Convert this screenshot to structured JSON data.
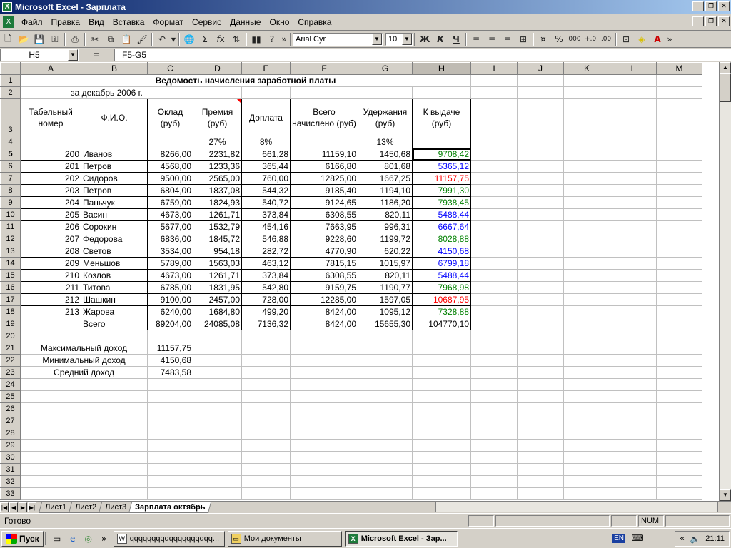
{
  "window": {
    "title": "Microsoft Excel - Зарплата"
  },
  "menu": [
    "Файл",
    "Правка",
    "Вид",
    "Вставка",
    "Формат",
    "Сервис",
    "Данные",
    "Окно",
    "Справка"
  ],
  "toolbar": {
    "font": "Arial Cyr",
    "size": "10"
  },
  "formula_bar": {
    "cell": "H5",
    "eq": "=",
    "formula": "=F5-G5"
  },
  "columns": [
    "A",
    "B",
    "C",
    "D",
    "E",
    "F",
    "G",
    "H",
    "I",
    "J",
    "K",
    "L",
    "M"
  ],
  "sheet": {
    "title": "Ведомость начисления заработной платы",
    "subtitle": "за декабрь 2006 г.",
    "headers": [
      "Табельный номер",
      "Ф.И.О.",
      "Оклад (руб)",
      "Премия (руб)",
      "Доплата",
      "Всего начислено (руб)",
      "Удержания (руб)",
      "К выдаче (руб)"
    ],
    "rates": {
      "premium": "27%",
      "extra": "8%",
      "deduction": "13%"
    },
    "rows": [
      {
        "n": "5",
        "id": "200",
        "name": "Иванов",
        "salary": "8266,00",
        "premium": "2231,82",
        "extra": "661,28",
        "total": "11159,10",
        "ded": "1450,68",
        "pay": "9708,42",
        "color": "green"
      },
      {
        "n": "6",
        "id": "201",
        "name": "Петров",
        "salary": "4568,00",
        "premium": "1233,36",
        "extra": "365,44",
        "total": "6166,80",
        "ded": "801,68",
        "pay": "5365,12",
        "color": "blue"
      },
      {
        "n": "7",
        "id": "202",
        "name": "Сидоров",
        "salary": "9500,00",
        "premium": "2565,00",
        "extra": "760,00",
        "total": "12825,00",
        "ded": "1667,25",
        "pay": "11157,75",
        "color": "red"
      },
      {
        "n": "8",
        "id": "203",
        "name": "Петров",
        "salary": "6804,00",
        "premium": "1837,08",
        "extra": "544,32",
        "total": "9185,40",
        "ded": "1194,10",
        "pay": "7991,30",
        "color": "green"
      },
      {
        "n": "9",
        "id": "204",
        "name": "Паньчук",
        "salary": "6759,00",
        "premium": "1824,93",
        "extra": "540,72",
        "total": "9124,65",
        "ded": "1186,20",
        "pay": "7938,45",
        "color": "green"
      },
      {
        "n": "10",
        "id": "205",
        "name": "Васин",
        "salary": "4673,00",
        "premium": "1261,71",
        "extra": "373,84",
        "total": "6308,55",
        "ded": "820,11",
        "pay": "5488,44",
        "color": "blue"
      },
      {
        "n": "11",
        "id": "206",
        "name": "Сорокин",
        "salary": "5677,00",
        "premium": "1532,79",
        "extra": "454,16",
        "total": "7663,95",
        "ded": "996,31",
        "pay": "6667,64",
        "color": "blue"
      },
      {
        "n": "12",
        "id": "207",
        "name": "Федорова",
        "salary": "6836,00",
        "premium": "1845,72",
        "extra": "546,88",
        "total": "9228,60",
        "ded": "1199,72",
        "pay": "8028,88",
        "color": "green"
      },
      {
        "n": "13",
        "id": "208",
        "name": "Светов",
        "salary": "3534,00",
        "premium": "954,18",
        "extra": "282,72",
        "total": "4770,90",
        "ded": "620,22",
        "pay": "4150,68",
        "color": "blue"
      },
      {
        "n": "14",
        "id": "209",
        "name": "Меньшов",
        "salary": "5789,00",
        "premium": "1563,03",
        "extra": "463,12",
        "total": "7815,15",
        "ded": "1015,97",
        "pay": "6799,18",
        "color": "blue"
      },
      {
        "n": "15",
        "id": "210",
        "name": "Козлов",
        "salary": "4673,00",
        "premium": "1261,71",
        "extra": "373,84",
        "total": "6308,55",
        "ded": "820,11",
        "pay": "5488,44",
        "color": "blue"
      },
      {
        "n": "16",
        "id": "211",
        "name": "Титова",
        "salary": "6785,00",
        "premium": "1831,95",
        "extra": "542,80",
        "total": "9159,75",
        "ded": "1190,77",
        "pay": "7968,98",
        "color": "green"
      },
      {
        "n": "17",
        "id": "212",
        "name": "Шашкин",
        "salary": "9100,00",
        "premium": "2457,00",
        "extra": "728,00",
        "total": "12285,00",
        "ded": "1597,05",
        "pay": "10687,95",
        "color": "red"
      },
      {
        "n": "18",
        "id": "213",
        "name": "Жарова",
        "salary": "6240,00",
        "premium": "1684,80",
        "extra": "499,20",
        "total": "8424,00",
        "ded": "1095,12",
        "pay": "7328,88",
        "color": "green"
      }
    ],
    "total_row": {
      "label": "Всего",
      "salary": "89204,00",
      "premium": "24085,08",
      "extra": "7136,32",
      "total": "8424,00",
      "ded": "15655,30",
      "pay": "104770,10"
    },
    "stats": [
      {
        "label": "Максимальный доход",
        "value": "11157,75"
      },
      {
        "label": "Минимальный доход",
        "value": "4150,68"
      },
      {
        "label": "Средний доход",
        "value": "7483,58"
      }
    ]
  },
  "tabs": [
    "Лист1",
    "Лист2",
    "Лист3",
    "Зарплата октябрь"
  ],
  "status": {
    "text": "Готово",
    "num": "NUM"
  },
  "taskbar": {
    "start": "Пуск",
    "tasks": [
      "qqqqqqqqqqqqqqqqqqq...",
      "Мои документы",
      "Microsoft Excel - Зар..."
    ],
    "lang": "EN",
    "time": "21:11"
  },
  "colors": {
    "green": "#008000",
    "blue": "#0000ff",
    "red": "#ff0000"
  }
}
